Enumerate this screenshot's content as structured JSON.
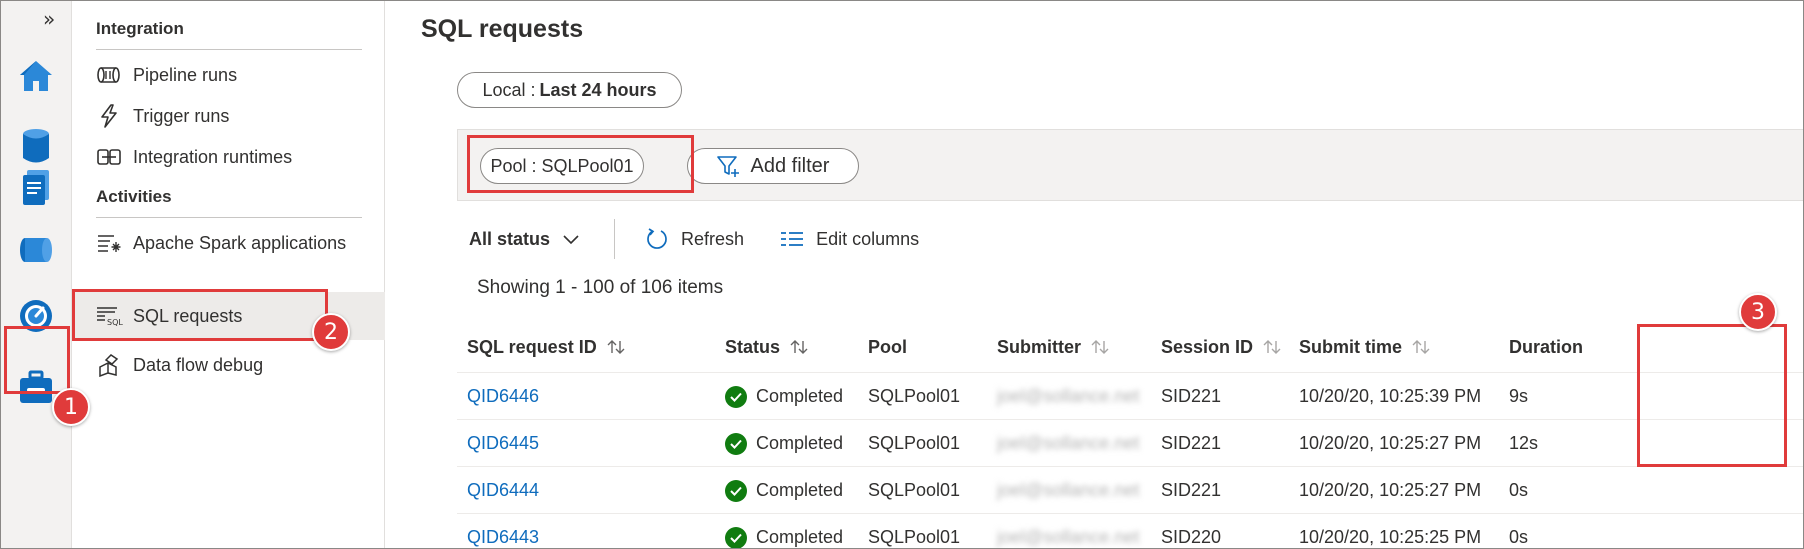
{
  "rail": {
    "expand_glyph": "»",
    "icons": [
      "home-icon",
      "data-icon",
      "develop-icon",
      "integrate-icon",
      "monitor-icon",
      "manage-icon"
    ],
    "accent": "#0f6cbd"
  },
  "nav": {
    "integration_title": "Integration",
    "activities_title": "Activities",
    "items": [
      {
        "label": "Pipeline runs",
        "icon": "pipeline-icon"
      },
      {
        "label": "Trigger runs",
        "icon": "trigger-icon"
      },
      {
        "label": "Integration runtimes",
        "icon": "runtime-icon"
      },
      {
        "label": "Apache Spark applications",
        "icon": "spark-icon"
      },
      {
        "label": "SQL requests",
        "icon": "sql-icon",
        "selected": true
      },
      {
        "label": "Data flow debug",
        "icon": "dataflow-icon"
      }
    ]
  },
  "main": {
    "title": "SQL requests",
    "time_filter": {
      "prefix": "Local :",
      "value": "Last 24 hours"
    },
    "pool_filter": "Pool : SQLPool01",
    "add_filter": "Add filter",
    "status_dropdown": "All status",
    "refresh": "Refresh",
    "edit_columns": "Edit columns",
    "showing": "Showing 1 - 100 of 106 items"
  },
  "table": {
    "columns": [
      "SQL request ID",
      "Status",
      "Pool",
      "Submitter",
      "Session ID",
      "Submit time",
      "Duration"
    ],
    "rows": [
      {
        "id": "QID6446",
        "status": "Completed",
        "pool": "SQLPool01",
        "submitter": "joel@sollance.net",
        "session": "SID221",
        "submit_time": "10/20/20, 10:25:39 PM",
        "duration": "9s"
      },
      {
        "id": "QID6445",
        "status": "Completed",
        "pool": "SQLPool01",
        "submitter": "joel@sollance.net",
        "session": "SID221",
        "submit_time": "10/20/20, 10:25:27 PM",
        "duration": "12s"
      },
      {
        "id": "QID6444",
        "status": "Completed",
        "pool": "SQLPool01",
        "submitter": "joel@sollance.net",
        "session": "SID221",
        "submit_time": "10/20/20, 10:25:27 PM",
        "duration": "0s"
      },
      {
        "id": "QID6443",
        "status": "Completed",
        "pool": "SQLPool01",
        "submitter": "joel@sollance.net",
        "session": "SID220",
        "submit_time": "10/20/20, 10:25:25 PM",
        "duration": "0s"
      }
    ]
  },
  "callouts": {
    "one": "1",
    "two": "2",
    "three": "3",
    "color": "#e03b3b"
  }
}
